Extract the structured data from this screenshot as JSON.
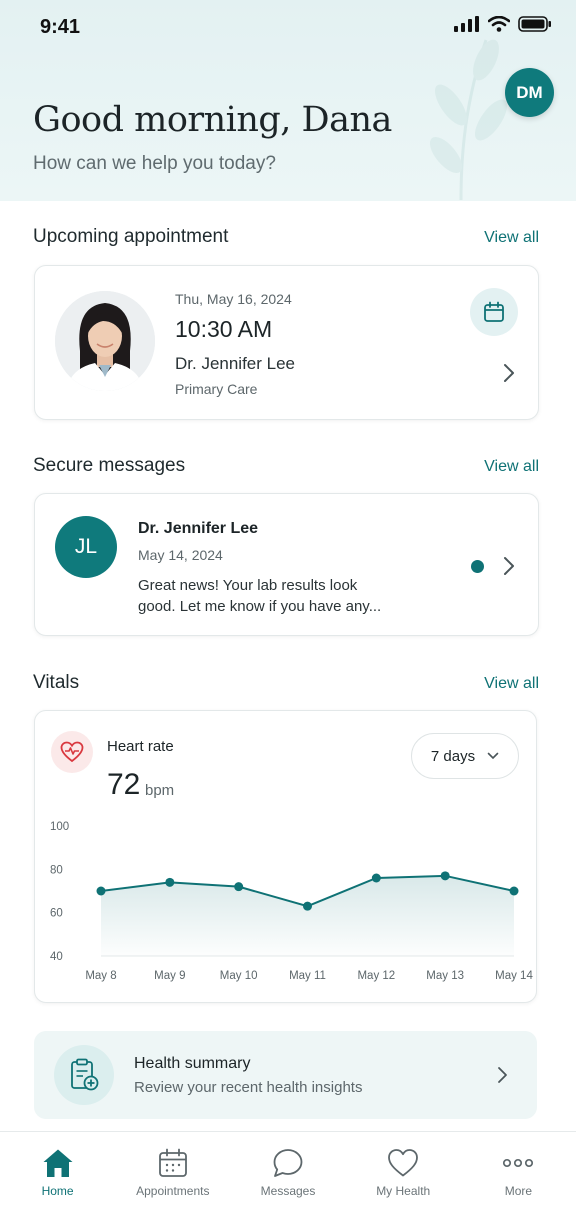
{
  "status_bar": {
    "time": "9:41"
  },
  "header": {
    "greeting": "Good morning, Dana",
    "subtitle": "How can we help you today?",
    "avatar_initials": "DM"
  },
  "upcoming": {
    "title": "Upcoming appointment",
    "view_all": "View all",
    "date": "Thu, May 16, 2024",
    "time": "10:30 AM",
    "doctor": "Dr. Jennifer Lee",
    "specialty": "Primary Care"
  },
  "messages": {
    "title": "Secure messages",
    "view_all": "View all",
    "avatar_initials": "JL",
    "from": "Dr. Jennifer Lee",
    "date": "May 14, 2024",
    "preview_line1": "Great news! Your lab results look",
    "preview_line2": "good. Let me know if you have any..."
  },
  "vitals": {
    "title": "Vitals",
    "view_all": "View all",
    "metric_label": "Heart rate",
    "metric_value": "72",
    "metric_unit": "bpm",
    "range_selected": "7 days"
  },
  "chart_data": {
    "type": "area",
    "x": [
      "May 8",
      "May 9",
      "May 10",
      "May 11",
      "May 12",
      "May 13",
      "May 14"
    ],
    "values": [
      70,
      74,
      72,
      63,
      76,
      77,
      70
    ],
    "ylim": [
      40,
      100
    ],
    "yticks": [
      100,
      80,
      60,
      40
    ],
    "series_color": "#0f7275"
  },
  "summary": {
    "title": "Health summary",
    "subtitle": "Review your recent health insights"
  },
  "tabbar": {
    "items": [
      {
        "label": "Home",
        "icon": "home-icon",
        "active": true
      },
      {
        "label": "Appointments",
        "icon": "calendar-icon",
        "active": false
      },
      {
        "label": "Messages",
        "icon": "chat-bubble-icon",
        "active": false
      },
      {
        "label": "My Health",
        "icon": "heart-icon",
        "active": false
      },
      {
        "label": "More",
        "icon": "more-dots-icon",
        "active": false
      }
    ]
  },
  "colors": {
    "accent": "#0f7275",
    "hero_bg": "#e3f1f2",
    "heart_red": "#d9383f"
  }
}
